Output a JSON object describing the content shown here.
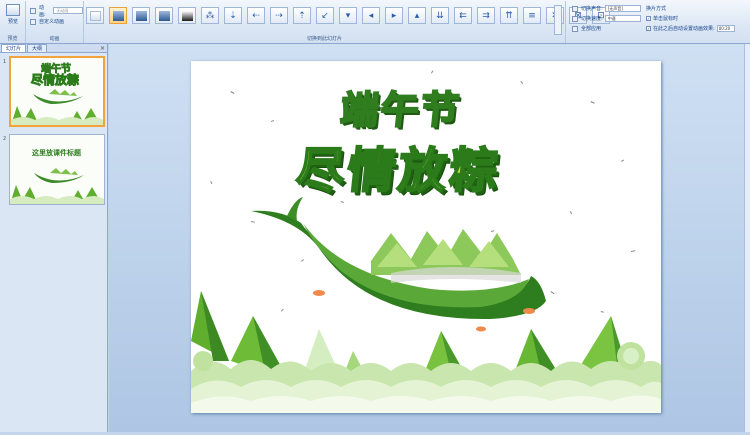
{
  "ribbon": {
    "preview": {
      "label": "预览",
      "group": "预览"
    },
    "animations": {
      "animate_label": "动画:",
      "animate_value": "无动画",
      "custom_label": "自定义动画",
      "group": "动画"
    },
    "transitions": {
      "group": "切换到此幻灯片",
      "gallery": [
        "none",
        "fade-smooth",
        "fade-black",
        "cut",
        "cut-black",
        "dissolve",
        "cover-down",
        "cover-left",
        "cover-right",
        "cover-up",
        "cover-left-down",
        "wipe-down",
        "wipe-left",
        "wipe-right",
        "wipe-up",
        "push-down",
        "push-left",
        "push-right",
        "push-up",
        "strips",
        "shape-plus",
        "shape-out",
        "shape-in"
      ]
    },
    "sound": {
      "label": "切换声音:",
      "value": "[无声音]"
    },
    "speed": {
      "label": "切换速度:",
      "value": "中速"
    },
    "apply_all": "全部应用",
    "advance": {
      "title": "换片方式",
      "on_click": "单击鼠标时",
      "auto_after": "在此之后自动设置动画效果:",
      "time": "00:20"
    }
  },
  "panel": {
    "tabs": [
      {
        "label": "幻灯片"
      },
      {
        "label": "大纲"
      }
    ],
    "close": "×",
    "slides": [
      {
        "num": "1",
        "title_top": "端午节",
        "title_main": "尽情放粽",
        "selected": true
      },
      {
        "num": "2",
        "title_main": "这里放课件标题",
        "selected": false
      }
    ]
  },
  "slide": {
    "title_top": "端午节",
    "title_main": "尽情放粽"
  },
  "colors": {
    "accent": "#2f7d1f",
    "title_lime": "#c4e64a",
    "ribbon": "#dde8f5",
    "selection": "#f0a43a"
  }
}
